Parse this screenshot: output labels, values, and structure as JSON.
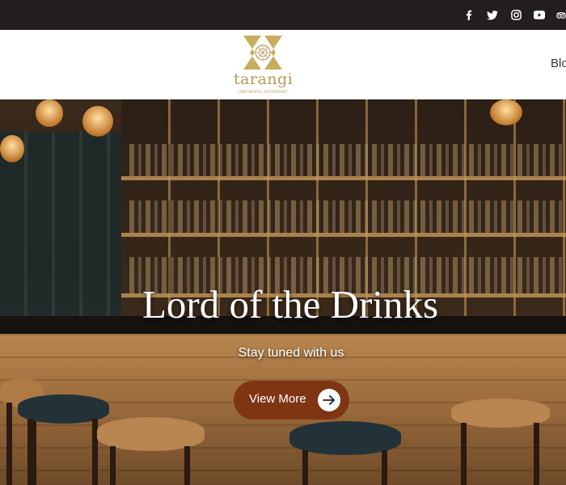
{
  "topbar": {
    "social_icons": [
      "facebook-icon",
      "twitter-icon",
      "instagram-icon",
      "youtube-icon",
      "tripadvisor-icon"
    ]
  },
  "header": {
    "logo_text": "tarangi",
    "logo_tagline": "CONTINENTAL RESTAURANT",
    "nav_partial": "Blo"
  },
  "hero": {
    "title": "Lord of the Drinks",
    "subtitle": "Stay tuned with us",
    "cta_label": "View More"
  },
  "colors": {
    "topbar": "#231f20",
    "brand_gold": "#b59a58",
    "cta": "#7f3512"
  }
}
